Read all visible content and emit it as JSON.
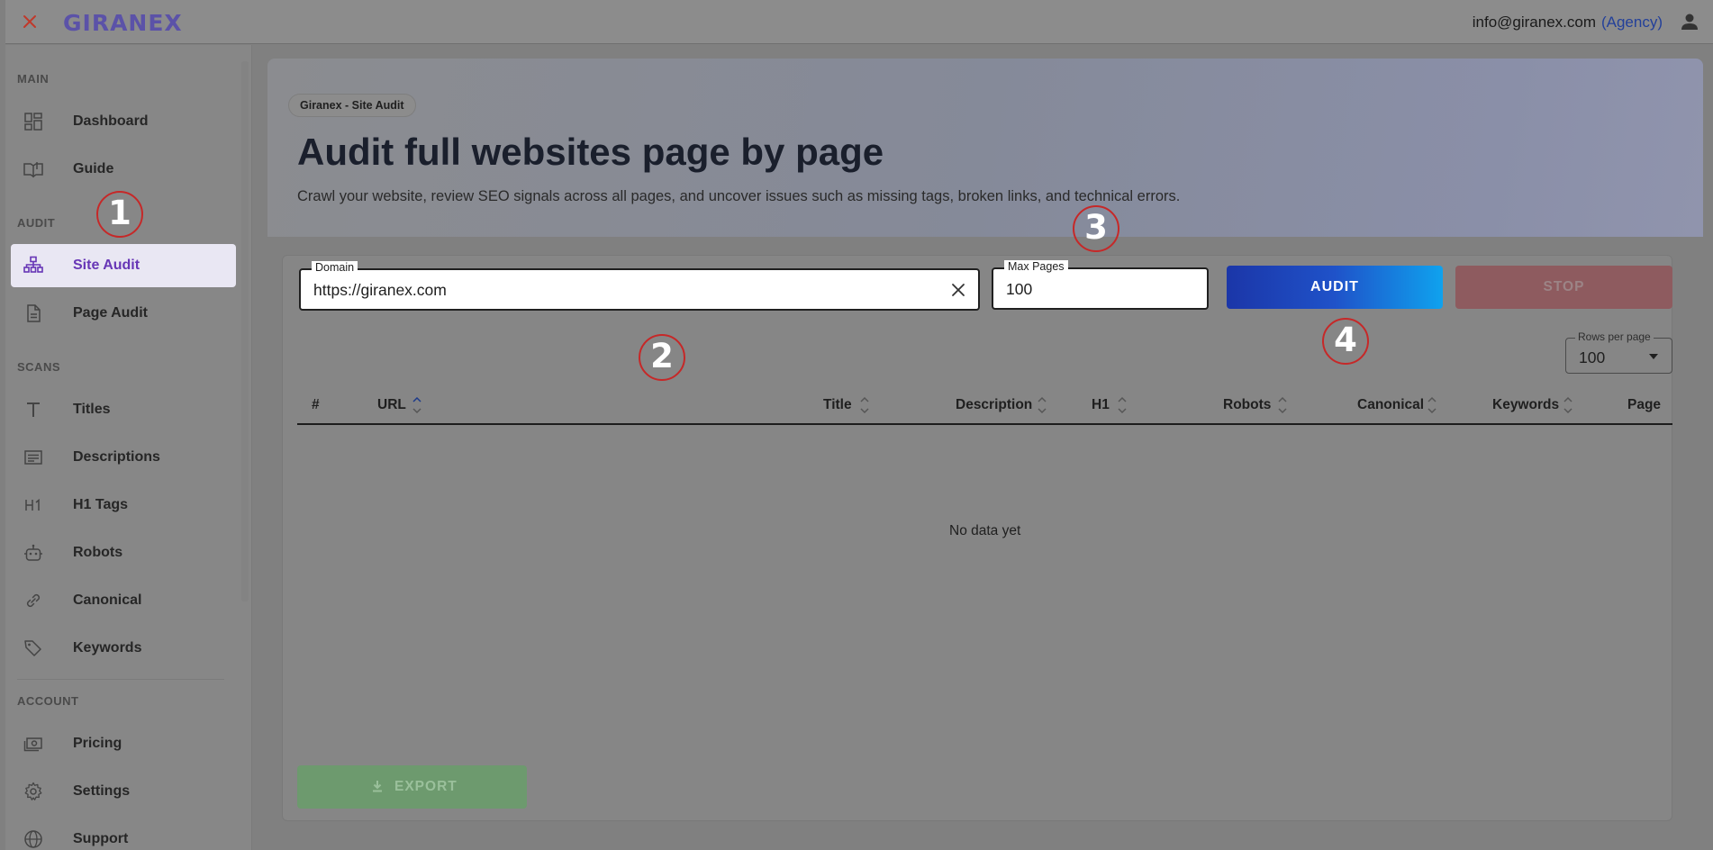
{
  "topbar": {
    "brand": "GIRANEX",
    "user_email": "info@giranex.com",
    "user_role": "(Agency)"
  },
  "sidebar": {
    "sections": [
      {
        "label": "MAIN"
      },
      {
        "label": "AUDIT"
      },
      {
        "label": "SCANS"
      },
      {
        "label": "ACCOUNT"
      }
    ],
    "items": [
      {
        "label": "Dashboard",
        "icon": "dashboard-icon"
      },
      {
        "label": "Guide",
        "icon": "book-icon"
      },
      {
        "label": "Site Audit",
        "icon": "sitemap-icon",
        "active": true
      },
      {
        "label": "Page Audit",
        "icon": "document-icon"
      },
      {
        "label": "Titles",
        "icon": "title-icon"
      },
      {
        "label": "Descriptions",
        "icon": "description-icon"
      },
      {
        "label": "H1 Tags",
        "icon": "h1-icon"
      },
      {
        "label": "Robots",
        "icon": "robot-icon"
      },
      {
        "label": "Canonical",
        "icon": "link-icon"
      },
      {
        "label": "Keywords",
        "icon": "tag-icon"
      },
      {
        "label": "Pricing",
        "icon": "money-icon"
      },
      {
        "label": "Settings",
        "icon": "gear-icon"
      },
      {
        "label": "Support",
        "icon": "globe-icon"
      }
    ]
  },
  "hero": {
    "chip": "Giranex - Site Audit",
    "title": "Audit full websites page by page",
    "subtitle": "Crawl your website, review SEO signals across all pages, and uncover issues such as missing tags, broken links, and technical errors."
  },
  "form": {
    "domain_label": "Domain",
    "domain_value": "https://giranex.com",
    "max_pages_label": "Max Pages",
    "max_pages_value": "100",
    "audit_label": "AUDIT",
    "stop_label": "STOP"
  },
  "table": {
    "rows_per_page_label": "Rows per page",
    "rows_per_page_value": "100",
    "columns": [
      "#",
      "URL",
      "Title",
      "Description",
      "H1",
      "Robots",
      "Canonical",
      "Keywords",
      "Page"
    ],
    "empty_message": "No data yet",
    "export_label": "EXPORT"
  },
  "annotations": [
    "1",
    "2",
    "3",
    "4"
  ],
  "colors": {
    "accent": "#6736b6",
    "audit_button_start": "#1b36a8",
    "audit_button_end": "#0fa2ee",
    "stop_button": "#8e5b5f",
    "export_button": "#6d9a6e",
    "annotation_ring": "#c62828"
  }
}
